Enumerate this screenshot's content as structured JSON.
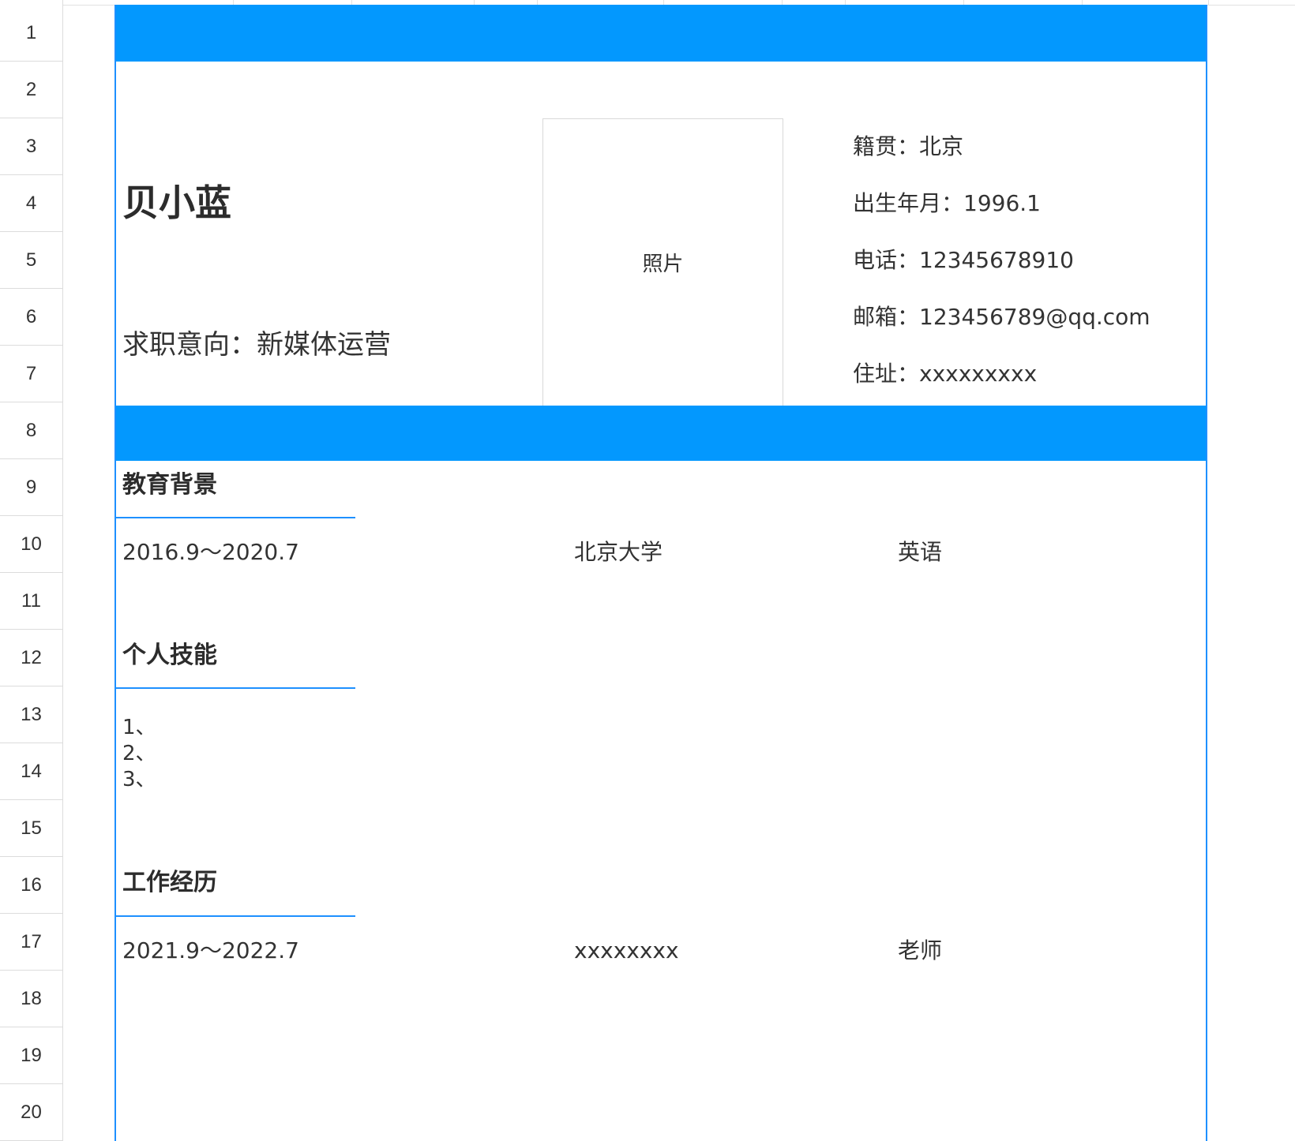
{
  "row_headers": [
    "1",
    "2",
    "3",
    "4",
    "5",
    "6",
    "7",
    "8",
    "9",
    "10",
    "11",
    "12",
    "13",
    "14",
    "15",
    "16",
    "17",
    "18",
    "19",
    "20"
  ],
  "theme": {
    "accent": "#0398fe",
    "border": "#1e90ff"
  },
  "header": {
    "name": "贝小蓝",
    "job_intent": "求职意向：新媒体运营",
    "photo_label": "照片",
    "info": {
      "hometown": "籍贯：北京",
      "birth": "出生年月：1996.1",
      "phone": "电话：12345678910",
      "email": "邮箱：123456789@qq.com",
      "address": "住址：xxxxxxxxx"
    }
  },
  "education": {
    "title": "教育背景",
    "entries": [
      {
        "period": "2016.9～2020.7",
        "school": "北京大学",
        "major": "英语"
      }
    ]
  },
  "skills": {
    "title": "个人技能",
    "items": [
      "1、",
      "2、",
      "3、"
    ]
  },
  "work": {
    "title": "工作经历",
    "entries": [
      {
        "period": "2021.9～2022.7",
        "company": "xxxxxxxx",
        "role": "老师"
      }
    ]
  }
}
